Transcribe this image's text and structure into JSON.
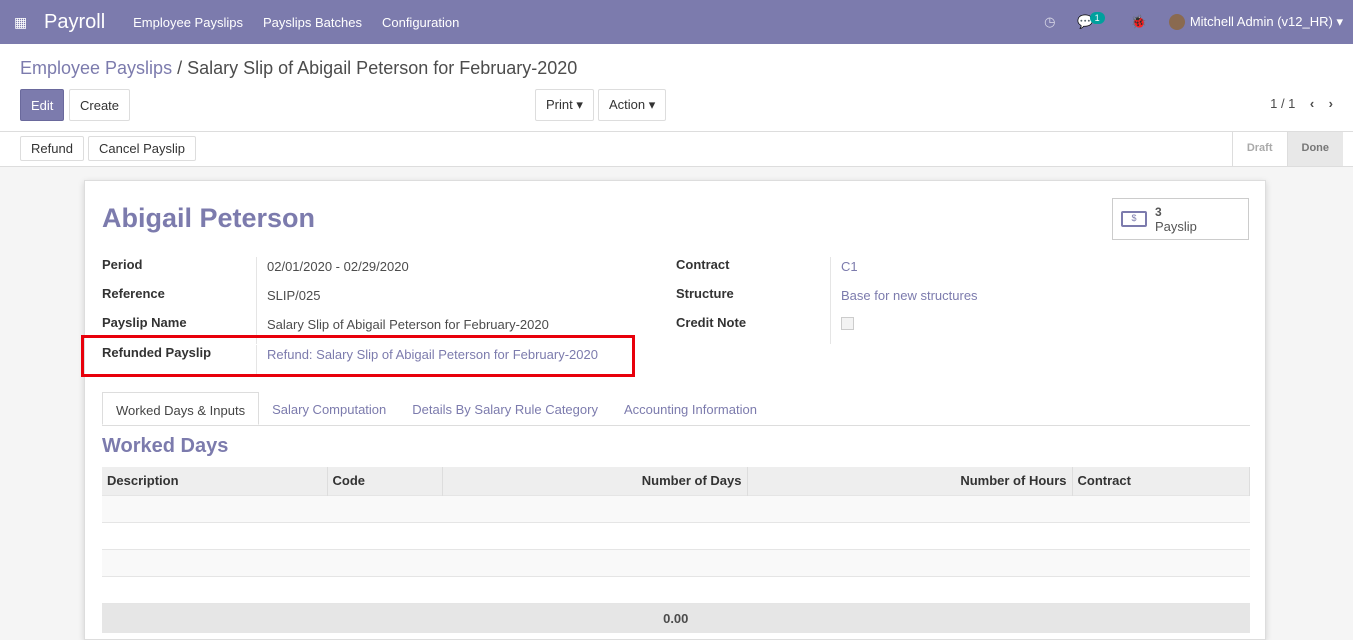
{
  "nav": {
    "app": "Payroll",
    "menus": [
      "Employee Payslips",
      "Payslips Batches",
      "Configuration"
    ],
    "chat_count": "1",
    "user": "Mitchell Admin (v12_HR)"
  },
  "breadcrumb": {
    "parent": "Employee Payslips",
    "current": "Salary Slip of Abigail Peterson for February-2020"
  },
  "buttons": {
    "edit": "Edit",
    "create": "Create",
    "print": "Print",
    "action": "Action",
    "refund": "Refund",
    "cancel": "Cancel Payslip"
  },
  "pager": "1 / 1",
  "status": {
    "draft": "Draft",
    "done": "Done"
  },
  "employee": "Abigail Peterson",
  "smart": {
    "count": "3",
    "label": "Payslip"
  },
  "fields": {
    "period_l": "Period",
    "period": "02/01/2020 - 02/29/2020",
    "ref_l": "Reference",
    "ref": "SLIP/025",
    "name_l": "Payslip Name",
    "name": "Salary Slip of Abigail Peterson for February-2020",
    "refunded_l": "Refunded Payslip",
    "refunded": "Refund: Salary Slip of Abigail Peterson for February-2020",
    "contract_l": "Contract",
    "contract": "C1",
    "structure_l": "Structure",
    "structure": "Base for new structures",
    "credit_l": "Credit Note"
  },
  "tabs": [
    "Worked Days & Inputs",
    "Salary Computation",
    "Details By Salary Rule Category",
    "Accounting Information"
  ],
  "section": "Worked Days",
  "table": {
    "headers": [
      "Description",
      "Code",
      "Number of Days",
      "Number of Hours",
      "Contract"
    ],
    "total": "0.00"
  }
}
